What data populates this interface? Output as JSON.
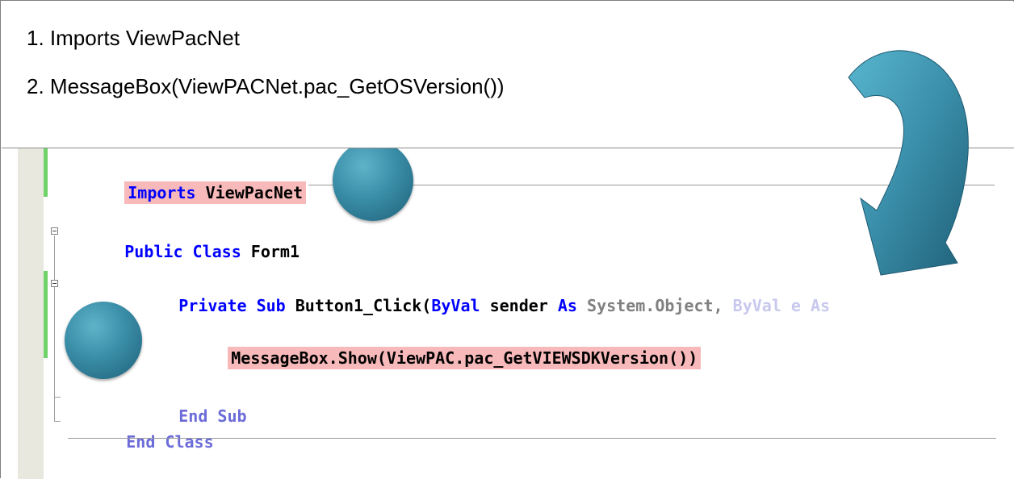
{
  "instructions": {
    "step1": "1. Imports ViewPacNet",
    "step2": "2. MessageBox(ViewPACNet.pac_GetOSVersion())"
  },
  "code": {
    "line1_keyword": "Imports",
    "line1_rest": " ViewPacNet",
    "line2_kw1": "Public",
    "line2_kw2": "Class",
    "line2_rest": " Form1",
    "line3_kw1": "Private",
    "line3_kw2": "Sub",
    "line3_name": " Button1_Click(",
    "line3_kw3": "ByVal",
    "line3_param": " sender ",
    "line3_kw4": "As",
    "line3_type_a": " System.Object,",
    "line3_faded": " ByVal e As",
    "line4_text": "MessageBox.Show(ViewPAC.pac_GetVIEWSDKVersion())",
    "line5_text": "End Sub",
    "line6_text": "End Class"
  },
  "colors": {
    "keyword": "#0000ff",
    "highlight": "#f7b9b9",
    "change_bar": "#6fd36a",
    "dot": "#3a8da7",
    "arrow": "#2f7f9a"
  },
  "icons": {
    "arrow": "curved-arrow-icon",
    "marker": "step-dot-icon",
    "fold": "collapse-box-icon"
  }
}
